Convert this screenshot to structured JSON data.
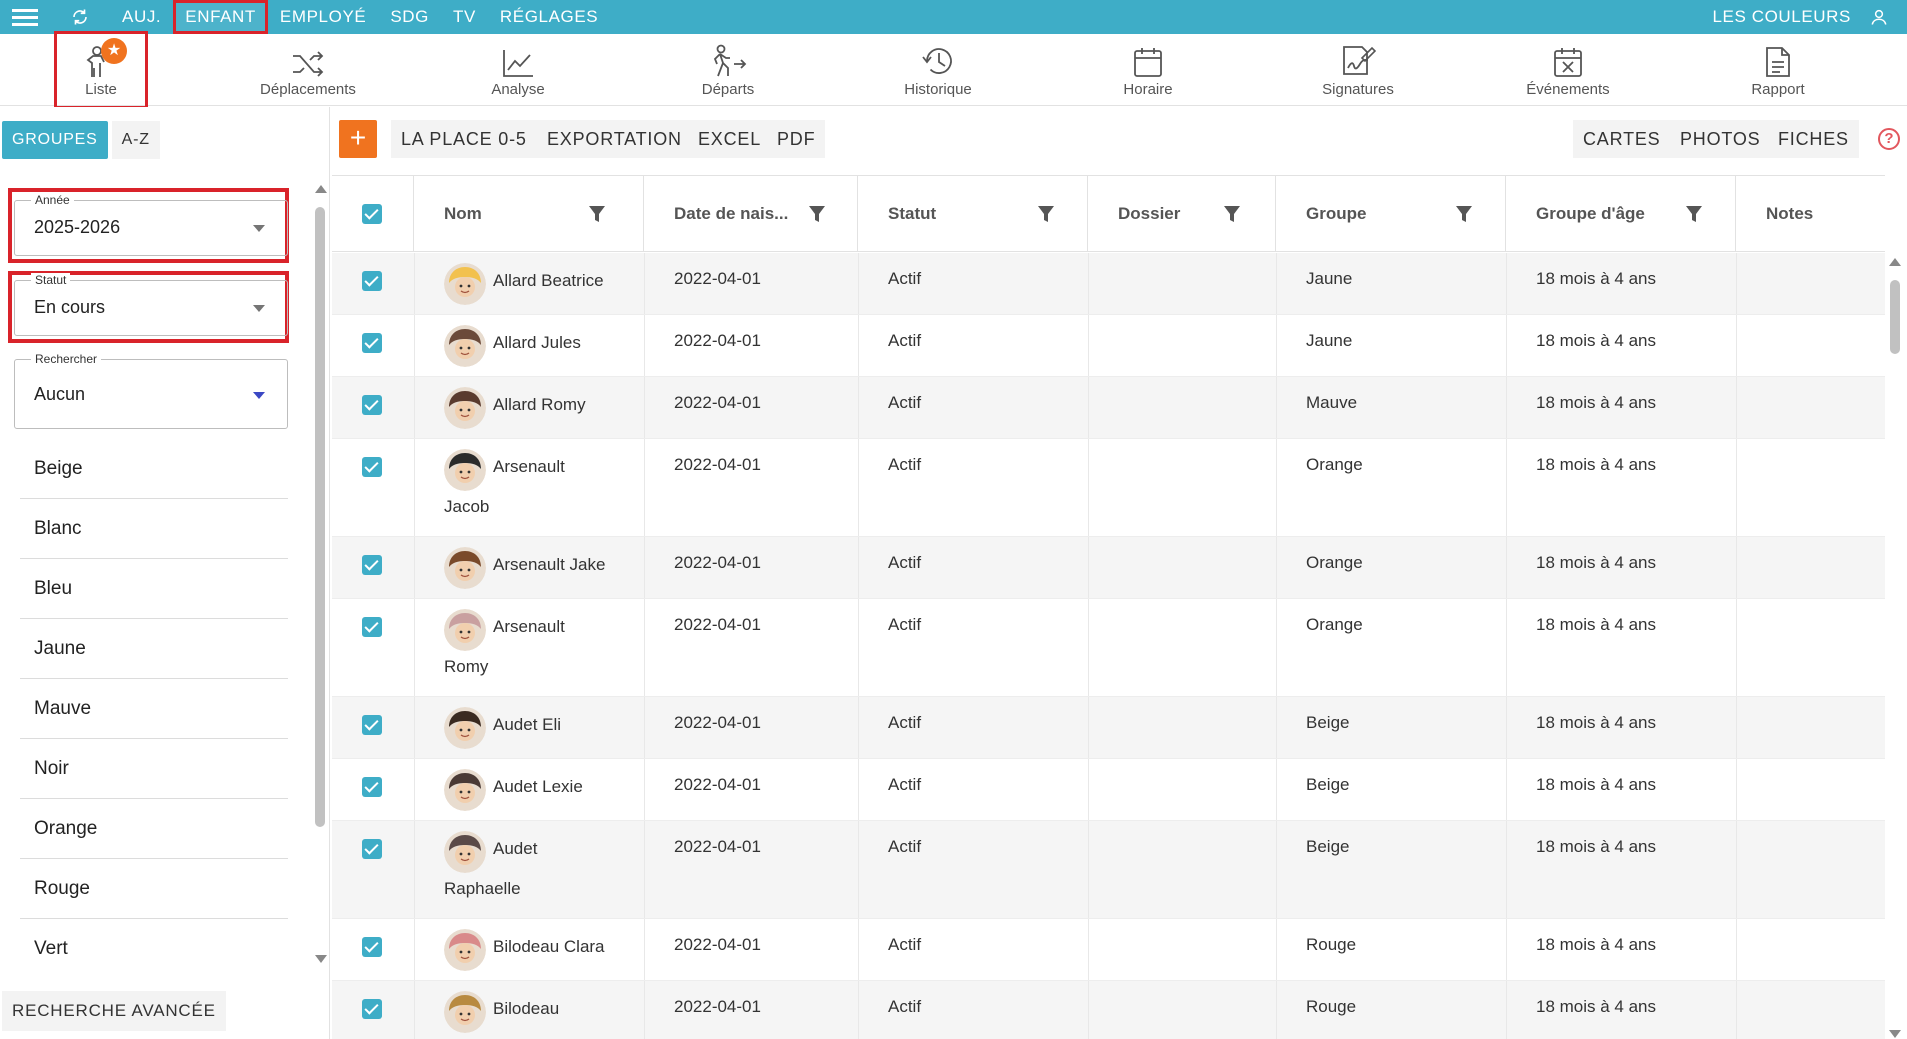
{
  "topnav": {
    "items": [
      "AUJ.",
      "ENFANT",
      "EMPLOYÉ",
      "SDG",
      "TV",
      "RÉGLAGES"
    ],
    "active": "ENFANT",
    "right_label": "LES COULEURS"
  },
  "modules": [
    "Liste",
    "Déplacements",
    "Analyse",
    "Départs",
    "Historique",
    "Horaire",
    "Signatures",
    "Événements",
    "Rapport"
  ],
  "sidebar": {
    "tab_groups": "GROUPES",
    "tab_az": "A-Z",
    "year": {
      "label": "Année",
      "value": "2025-2026"
    },
    "status": {
      "label": "Statut",
      "value": "En cours"
    },
    "search": {
      "label": "Rechercher",
      "value": "Aucun"
    },
    "groups": [
      "Beige",
      "Blanc",
      "Bleu",
      "Jaune",
      "Mauve",
      "Noir",
      "Orange",
      "Rouge",
      "Vert"
    ],
    "advanced_search": "RECHERCHE AVANCÉE"
  },
  "actions": {
    "plus": "+",
    "left": [
      "LA PLACE 0-5",
      "EXPORTATION",
      "EXCEL",
      "PDF"
    ],
    "right": [
      "CARTES",
      "PHOTOS",
      "FICHES"
    ],
    "help": "?"
  },
  "table": {
    "columns": [
      "Nom",
      "Date de nais...",
      "Statut",
      "Dossier",
      "Groupe",
      "Groupe d'âge",
      "Notes"
    ],
    "rows": [
      {
        "name1": "Allard Beatrice",
        "name2": "",
        "dob": "2022-04-01",
        "status": "Actif",
        "dossier": "",
        "group": "Jaune",
        "age_group": "18 mois à 4 ans",
        "avatar_color": "#f2c14e"
      },
      {
        "name1": "Allard Jules",
        "name2": "",
        "dob": "2022-04-01",
        "status": "Actif",
        "dossier": "",
        "group": "Jaune",
        "age_group": "18 mois à 4 ans",
        "avatar_color": "#6b4a3a"
      },
      {
        "name1": "Allard Romy",
        "name2": "",
        "dob": "2022-04-01",
        "status": "Actif",
        "dossier": "",
        "group": "Mauve",
        "age_group": "18 mois à 4 ans",
        "avatar_color": "#5a3b2e"
      },
      {
        "name1": "Arsenault",
        "name2": "Jacob",
        "dob": "2022-04-01",
        "status": "Actif",
        "dossier": "",
        "group": "Orange",
        "age_group": "18 mois à 4 ans",
        "avatar_color": "#2b2b2b"
      },
      {
        "name1": "Arsenault Jake",
        "name2": "",
        "dob": "2022-04-01",
        "status": "Actif",
        "dossier": "",
        "group": "Orange",
        "age_group": "18 mois à 4 ans",
        "avatar_color": "#7a4a2a"
      },
      {
        "name1": "Arsenault",
        "name2": "Romy",
        "dob": "2022-04-01",
        "status": "Actif",
        "dossier": "",
        "group": "Orange",
        "age_group": "18 mois à 4 ans",
        "avatar_color": "#c9a0a0"
      },
      {
        "name1": "Audet Eli",
        "name2": "",
        "dob": "2022-04-01",
        "status": "Actif",
        "dossier": "",
        "group": "Beige",
        "age_group": "18 mois à 4 ans",
        "avatar_color": "#3a2a20"
      },
      {
        "name1": "Audet Lexie",
        "name2": "",
        "dob": "2022-04-01",
        "status": "Actif",
        "dossier": "",
        "group": "Beige",
        "age_group": "18 mois à 4 ans",
        "avatar_color": "#4a3a35"
      },
      {
        "name1": "Audet",
        "name2": "Raphaelle",
        "dob": "2022-04-01",
        "status": "Actif",
        "dossier": "",
        "group": "Beige",
        "age_group": "18 mois à 4 ans",
        "avatar_color": "#5a4a48"
      },
      {
        "name1": "Bilodeau Clara",
        "name2": "",
        "dob": "2022-04-01",
        "status": "Actif",
        "dossier": "",
        "group": "Rouge",
        "age_group": "18 mois à 4 ans",
        "avatar_color": "#d98a8a"
      },
      {
        "name1": "Bilodeau",
        "name2": "",
        "dob": "2022-04-01",
        "status": "Actif",
        "dossier": "",
        "group": "Rouge",
        "age_group": "18 mois à 4 ans",
        "avatar_color": "#b88a40"
      }
    ]
  },
  "colors": {
    "accent": "#3eadc7",
    "orange": "#f0731f",
    "highlight": "#d9232a"
  }
}
